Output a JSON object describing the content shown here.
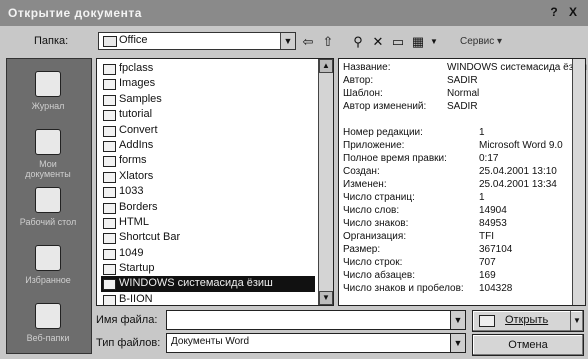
{
  "window": {
    "title": "Открытие документа",
    "help": "?",
    "close": "X"
  },
  "toolbar": {
    "lookin_label": "Папка:",
    "lookin_value": "Office",
    "tools_label": "Сервис"
  },
  "places": [
    {
      "label": "Журнал",
      "icon": "history-icon"
    },
    {
      "label": "Мои документы",
      "icon": "my-documents-icon"
    },
    {
      "label": "Рабочий стол",
      "icon": "desktop-icon"
    },
    {
      "label": "Избранное",
      "icon": "favorites-icon"
    },
    {
      "label": "Веб-папки",
      "icon": "web-folders-icon"
    }
  ],
  "files": [
    "fpclass",
    "Images",
    "Samples",
    "tutorial",
    "Convert",
    "AddIns",
    "forms",
    "Xlators",
    "1033",
    "Borders",
    "HTML",
    "Shortcut Bar",
    "1049",
    "Startup",
    "WINDOWS системасида ёзиш",
    "B-IION"
  ],
  "selected_index": 14,
  "properties": [
    {
      "key": "Название:",
      "value": "WINDOWS системасида ёзиш"
    },
    {
      "key": "Автор:",
      "value": "SADIR"
    },
    {
      "key": "Шаблон:",
      "value": "Normal"
    },
    {
      "key": "Автор изменений:",
      "value": "SADIR"
    },
    {
      "key": "Номер редакции:",
      "value": "1"
    },
    {
      "key": "Приложение:",
      "value": "Microsoft Word 9.0"
    },
    {
      "key": "Полное время правки:",
      "value": "0:17"
    },
    {
      "key": "Создан:",
      "value": "25.04.2001 13:10"
    },
    {
      "key": "Изменен:",
      "value": "25.04.2001 13:34"
    },
    {
      "key": "Число страниц:",
      "value": "1"
    },
    {
      "key": "Число слов:",
      "value": "14904"
    },
    {
      "key": "Число знаков:",
      "value": "84953"
    },
    {
      "key": "Организация:",
      "value": "TFI"
    },
    {
      "key": "Размер:",
      "value": "367104"
    },
    {
      "key": "Число строк:",
      "value": "707"
    },
    {
      "key": "Число абзацев:",
      "value": "169"
    },
    {
      "key": "Число знаков и пробелов:",
      "value": "104328"
    }
  ],
  "filename": {
    "label": "Имя файла:",
    "value": ""
  },
  "filetype": {
    "label": "Тип файлов:",
    "value": "Документы Word"
  },
  "buttons": {
    "open": "Открыть",
    "cancel": "Отмена"
  }
}
